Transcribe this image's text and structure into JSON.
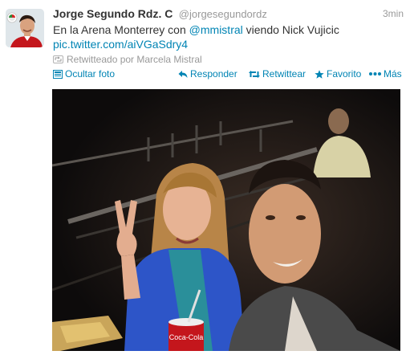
{
  "tweet": {
    "fullname": "Jorge Segundo Rdz. C",
    "username": "@jorgesegundordz",
    "time": "3min",
    "text_part1": "En la Arena Monterrey con ",
    "mention": "@mmistral",
    "text_part2": " viendo Nick Vujicic",
    "link": "pic.twitter.com/aiVGaSdry4",
    "retweeted_by": "Retwitteado por Marcela Mistral"
  },
  "actions": {
    "hide_photo": "Ocultar foto",
    "reply": "Responder",
    "retweet": "Retwittear",
    "favorite": "Favorito",
    "more": "Más"
  },
  "media": {
    "photo_cup_text": "Coca-Cola"
  },
  "colors": {
    "link": "#0084b4",
    "text": "#333333",
    "muted": "#999999"
  },
  "icons": [
    "photo-icon",
    "reply-icon",
    "retweet-icon",
    "star-icon",
    "more-icon",
    "retweet-small-icon"
  ]
}
